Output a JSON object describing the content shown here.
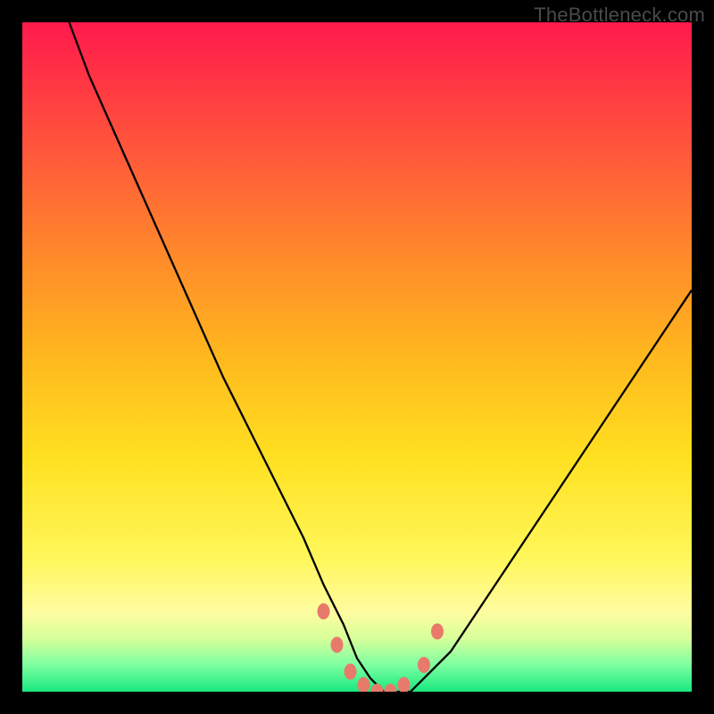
{
  "watermark": "TheBottleneck.com",
  "chart_data": {
    "type": "line",
    "title": "",
    "xlabel": "",
    "ylabel": "",
    "xlim": [
      0,
      100
    ],
    "ylim": [
      0,
      100
    ],
    "series": [
      {
        "name": "bottleneck-curve",
        "x": [
          7,
          10,
          14,
          18,
          22,
          26,
          30,
          34,
          38,
          42,
          45,
          48,
          50,
          52,
          54,
          56,
          58,
          60,
          64,
          68,
          72,
          76,
          80,
          84,
          88,
          92,
          96,
          100
        ],
        "values": [
          100,
          92,
          83,
          74,
          65,
          56,
          47,
          39,
          31,
          23,
          16,
          10,
          5,
          2,
          0,
          0,
          0,
          2,
          6,
          12,
          18,
          24,
          30,
          36,
          42,
          48,
          54,
          60
        ]
      }
    ],
    "markers": {
      "name": "highlighted-points",
      "color": "#e87a6b",
      "x": [
        45,
        47,
        49,
        51,
        53,
        55,
        57,
        60,
        62
      ],
      "values": [
        12,
        7,
        3,
        1,
        0,
        0,
        1,
        4,
        9
      ]
    },
    "gradient_bands": [
      {
        "color": "#ff1a4d",
        "stop": 0
      },
      {
        "color": "#ffb81e",
        "stop": 50
      },
      {
        "color": "#fff75a",
        "stop": 80
      },
      {
        "color": "#18e880",
        "stop": 100
      }
    ]
  }
}
